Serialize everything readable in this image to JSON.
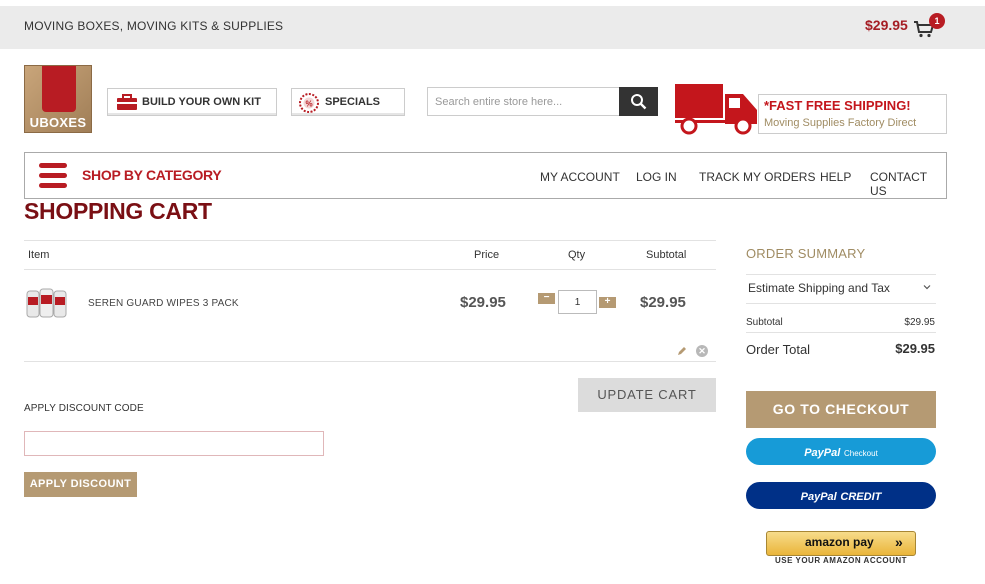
{
  "topbar": {
    "tagline": "MOVING BOXES, MOVING KITS & SUPPLIES",
    "cart_total": "$29.95",
    "cart_count": "1"
  },
  "header": {
    "logo_text": "UBOXES",
    "build_kit_label": "BUILD YOUR OWN KIT",
    "specials_label": "SPECIALS",
    "search_placeholder": "Search entire store here...",
    "shipping_title": "*FAST FREE SHIPPING!",
    "shipping_subtitle": "Moving Supplies Factory Direct"
  },
  "nav": {
    "shop_by_category": "SHOP BY CATEGORY",
    "links": [
      "MY ACCOUNT",
      "LOG IN",
      "TRACK MY ORDERS",
      "HELP",
      "CONTACT US"
    ]
  },
  "cart": {
    "title": "SHOPPING CART",
    "columns": [
      "Item",
      "Price",
      "Qty",
      "Subtotal"
    ],
    "items": [
      {
        "name": "SEREN GUARD WIPES 3 PACK",
        "price": "$29.95",
        "qty": "1",
        "subtotal": "$29.95"
      }
    ],
    "update_label": "UPDATE CART",
    "discount_label": "APPLY DISCOUNT CODE",
    "discount_value": "",
    "apply_label": "APPLY DISCOUNT"
  },
  "summary": {
    "title": "ORDER SUMMARY",
    "estimate_label": "Estimate Shipping and Tax",
    "subtotal_label": "Subtotal",
    "subtotal_value": "$29.95",
    "total_label": "Order Total",
    "total_value": "$29.95",
    "checkout_label": "GO TO CHECKOUT",
    "paypal_checkout": {
      "brand": "PayPal",
      "suffix": "Checkout"
    },
    "paypal_credit": {
      "brand": "PayPal",
      "suffix": "CREDIT"
    },
    "amazon_label": "amazon pay",
    "amazon_arrows": "»",
    "amazon_sub": "USE YOUR AMAZON ACCOUNT"
  },
  "colors": {
    "brand_red": "#b81c23",
    "dark_red": "#7a0f14",
    "gold": "#b59a73",
    "paypal_blue": "#179bd7",
    "paypal_navy": "#003087"
  },
  "icons": [
    "cart-icon",
    "briefcase-icon",
    "percent-badge-icon",
    "search-icon",
    "truck-icon",
    "menu-icon",
    "pencil-icon",
    "close-icon",
    "chevron-down-icon"
  ]
}
